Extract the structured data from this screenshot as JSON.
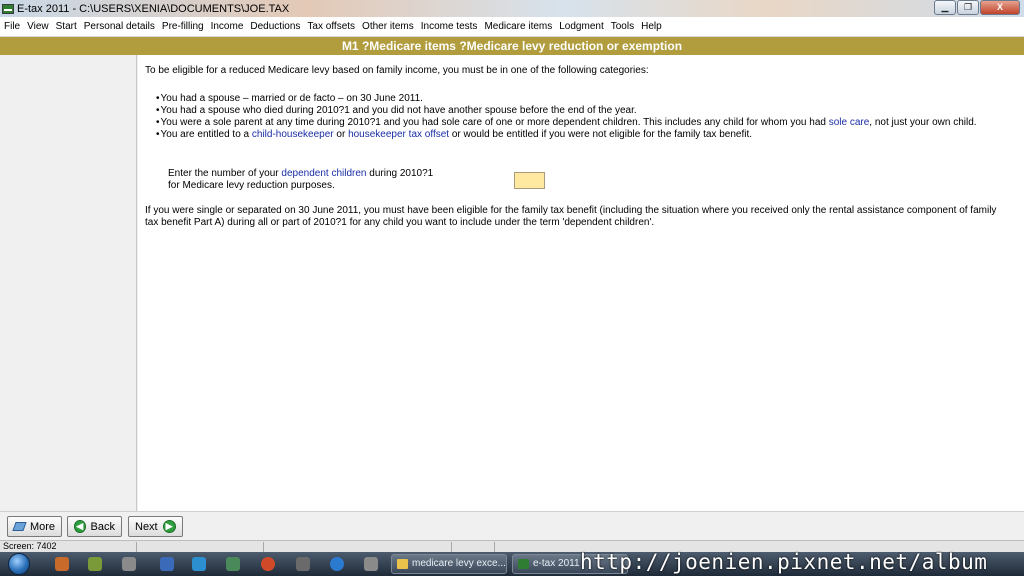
{
  "window": {
    "title": "E-tax 2011 - C:\\USERS\\XENIA\\DOCUMENTS\\JOE.TAX",
    "minimize_glyph": "▁",
    "maximize_glyph": "❐",
    "close_glyph": "X"
  },
  "menu": {
    "items": [
      "File",
      "View",
      "Start",
      "Personal details",
      "Pre-filling",
      "Income",
      "Deductions",
      "Tax offsets",
      "Other items",
      "Income tests",
      "Medicare items",
      "Lodgment",
      "Tools",
      "Help"
    ]
  },
  "section": {
    "title": "M1 ?Medicare items ?Medicare levy reduction or exemption"
  },
  "content": {
    "intro": "To be eligible for a reduced Medicare levy based on family income, you must be in one of the following categories:",
    "bullet1": "You had a spouse – married or de facto – on 30 June 2011.",
    "bullet2": "You had a spouse who died during 2010?1 and you did not have another spouse before the end of the year.",
    "bullet3_pre": "You were a sole parent at any time during 2010?1 and you had sole care of one or more dependent children. This includes any child for whom you had ",
    "bullet3_link": "sole care",
    "bullet3_post": ", not just your own child.",
    "bullet4_pre": "You are entitled to a ",
    "bullet4_link1": "child-housekeeper",
    "bullet4_mid": " or ",
    "bullet4_link2": "housekeeper tax offset",
    "bullet4_post": " or would be entitled if you were not eligible for the family tax benefit.",
    "question_pre": "Enter the number of your ",
    "question_link": "dependent children",
    "question_post": " during 2010?1",
    "question_line2": "for Medicare levy reduction purposes.",
    "input_value": "",
    "footer_note": "If you were single or separated on 30 June 2011, you must have been eligible for the family tax benefit (including the situation where you received only the rental assistance component of family tax benefit Part A) during all or part of 2010?1 for any child you want to include under the term 'dependent children'."
  },
  "nav": {
    "more": "More",
    "back": "Back",
    "next": "Next"
  },
  "status": {
    "text": "Screen: 7402"
  },
  "taskbar": {
    "task1": "medicare levy exce...",
    "task2": "e-tax 2011"
  },
  "watermark": "http://joenien.pixnet.net/album",
  "colors": {
    "header": "#b19c3e",
    "link": "#1a2ea6",
    "input_bg": "#ffe9a0"
  }
}
